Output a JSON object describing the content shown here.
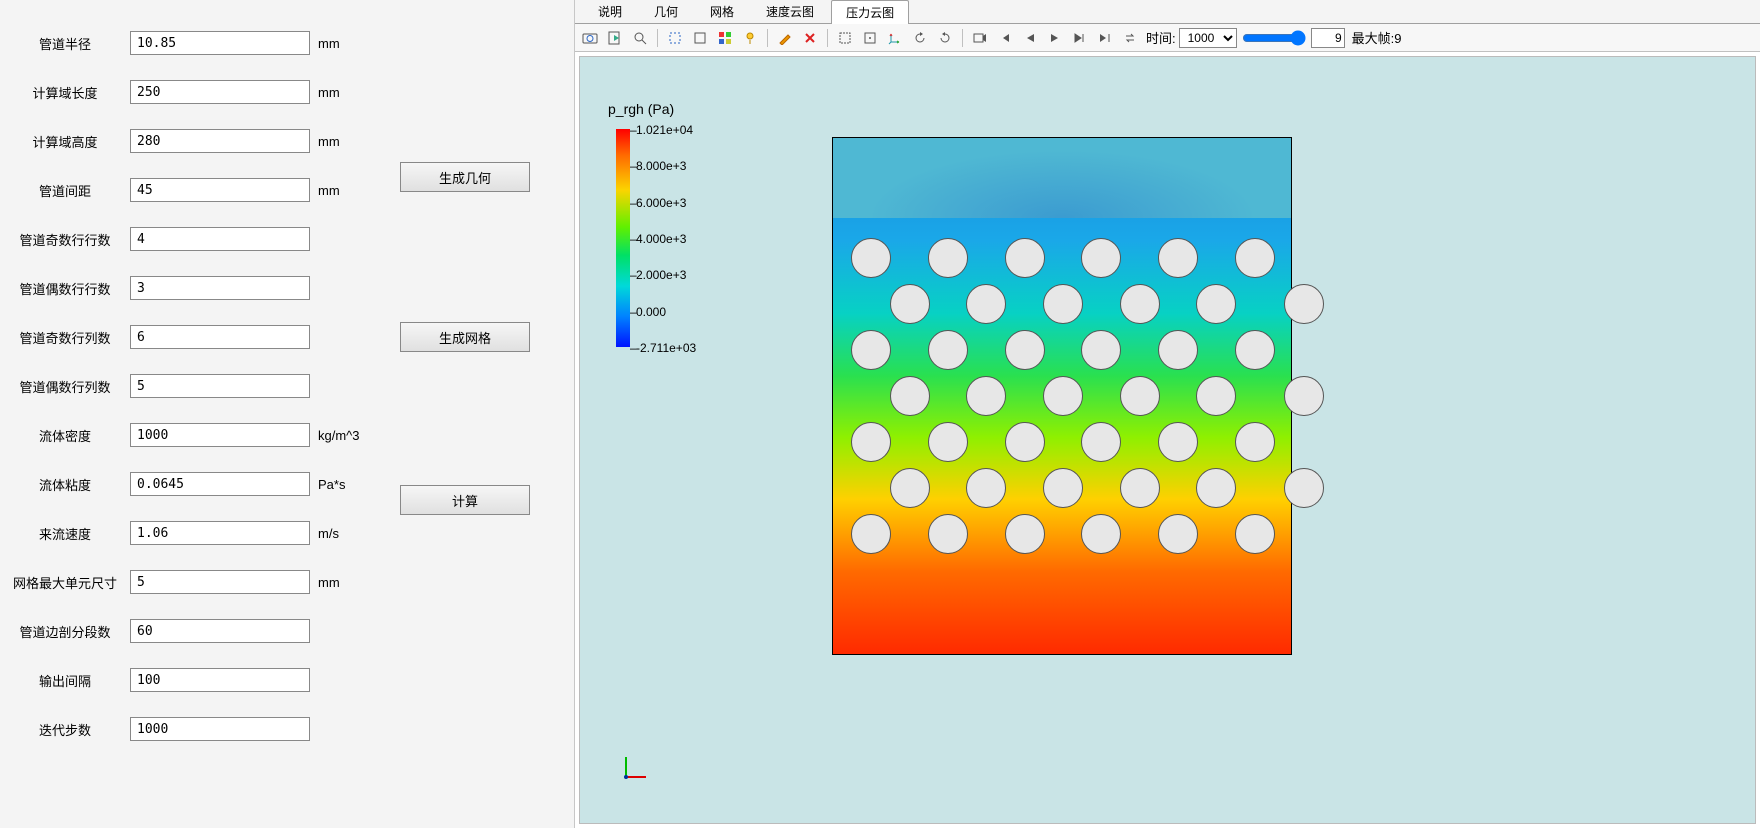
{
  "left": {
    "params": [
      {
        "label": "管道半径",
        "value": "10.85",
        "unit": "mm"
      },
      {
        "label": "计算域长度",
        "value": "250",
        "unit": "mm"
      },
      {
        "label": "计算域高度",
        "value": "280",
        "unit": "mm"
      },
      {
        "label": "管道间距",
        "value": "45",
        "unit": "mm"
      },
      {
        "label": "管道奇数行行数",
        "value": "4",
        "unit": ""
      },
      {
        "label": "管道偶数行行数",
        "value": "3",
        "unit": ""
      },
      {
        "label": "管道奇数行列数",
        "value": "6",
        "unit": ""
      },
      {
        "label": "管道偶数行列数",
        "value": "5",
        "unit": ""
      },
      {
        "label": "流体密度",
        "value": "1000",
        "unit": "kg/m^3"
      },
      {
        "label": "流体粘度",
        "value": "0.0645",
        "unit": "Pa*s"
      },
      {
        "label": "来流速度",
        "value": "1.06",
        "unit": "m/s"
      },
      {
        "label": "网格最大单元尺寸",
        "value": "5",
        "unit": "mm"
      },
      {
        "label": "管道边剖分段数",
        "value": "60",
        "unit": ""
      },
      {
        "label": "输出间隔",
        "value": "100",
        "unit": ""
      },
      {
        "label": "迭代步数",
        "value": "1000",
        "unit": ""
      }
    ],
    "buttons": {
      "geom": "生成几何",
      "mesh": "生成网格",
      "calc": "计算"
    }
  },
  "tabs": {
    "items": [
      "说明",
      "几何",
      "网格",
      "速度云图",
      "压力云图"
    ],
    "active_index": 4
  },
  "toolbar": {
    "time_label": "时间:",
    "time_value": "1000",
    "frame_value": "9",
    "max_frame_label": "最大帧:9"
  },
  "legend": {
    "title": "p_rgh (Pa)",
    "ticks": [
      "1.021e+04",
      "8.000e+3",
      "6.000e+3",
      "4.000e+3",
      "2.000e+3",
      "0.000",
      "-2.711e+03"
    ]
  },
  "chart_data": {
    "type": "heatmap",
    "variable": "p_rgh",
    "unit": "Pa",
    "min": -2711,
    "max": 10210,
    "ticks": [
      -2711,
      0,
      2000,
      4000,
      6000,
      8000,
      10210
    ],
    "domain": {
      "width_mm": 250,
      "height_mm": 280
    },
    "pipe_bank": {
      "radius_mm": 10.85,
      "pitch_mm": 45,
      "odd_row_cols": 6,
      "even_row_cols": 5,
      "odd_row_count": 4,
      "even_row_count": 3,
      "arrangement": "staggered"
    },
    "colormap": "rainbow",
    "title": "压力云图"
  }
}
